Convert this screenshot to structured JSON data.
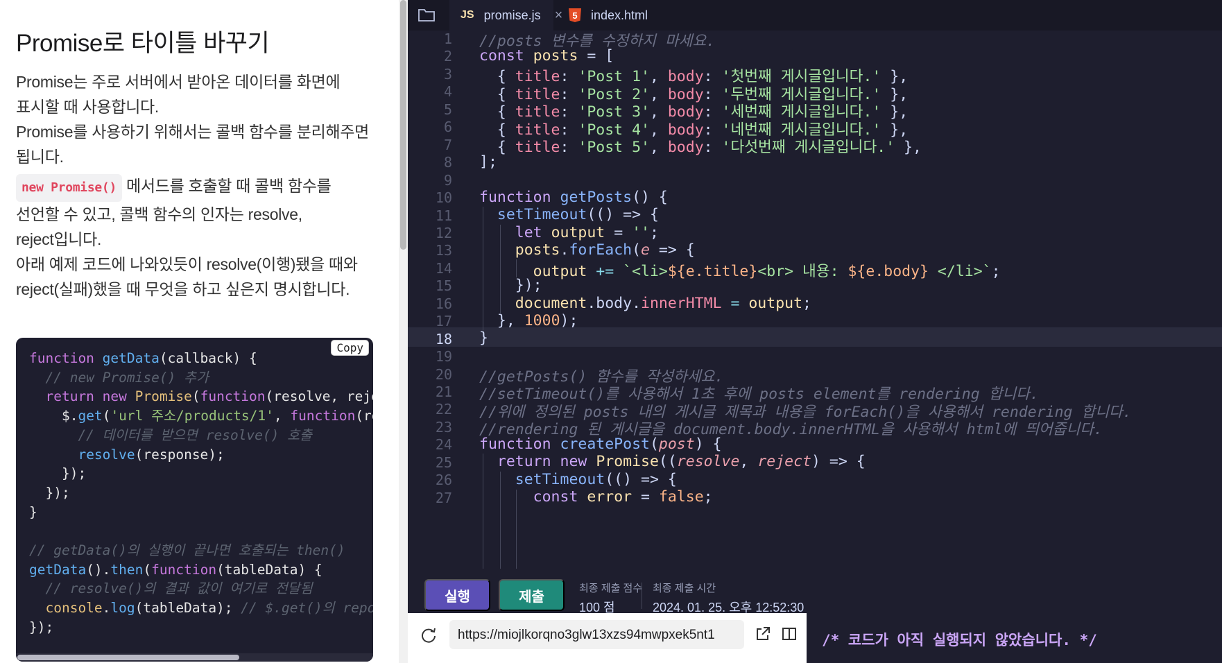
{
  "left": {
    "title": "Promise로 타이틀 바꾸기",
    "para1": [
      "Promise는 주로 서버에서 받아온 데이터를 화면에",
      "표시할 때 사용합니다.",
      "Promise를 사용하기 위해서는 콜백 함수를 분리해주면",
      "됩니다."
    ],
    "chip": "new Promise()",
    "para2_first": "메서드를 호출할 때 콜백 함수를",
    "para2": [
      "선언할 수 있고, 콜백 함수의 인자는 resolve,",
      "reject입니다.",
      "아래 예제 코드에 나와있듯이 resolve(이행)됐을 때와",
      "reject(실패)했을 때 무엇을 하고 싶은지 명시합니다."
    ],
    "copy_label": "Copy",
    "example": {
      "l1a": "function",
      "l1b": "getData",
      "l1c": "(callback) {",
      "l2": "  // new Promise() 추가",
      "l3a": "  return",
      "l3b": "new",
      "l3c": "Promise",
      "l3d": "(",
      "l3e": "function",
      "l3f": "(resolve, reject",
      "l4a": "    $.",
      "l4b": "get",
      "l4c": "(",
      "l4d": "'url 주소/products/1'",
      "l4e": ", ",
      "l4f": "function",
      "l4g": "(res",
      "l5": "      // 데이터를 받으면 resolve() 호출",
      "l6a": "      ",
      "l6b": "resolve",
      "l6c": "(response);",
      "l7": "    });",
      "l8": "  });",
      "l9": "}",
      "l10": "",
      "l11": "// getData()의 실행이 끝나면 호출되는 then()",
      "l12a": "getData",
      "l12b": "().",
      "l12c": "then",
      "l12d": "(",
      "l12e": "function",
      "l12f": "(tableData) {",
      "l13": "  // resolve()의 결과 값이 여기로 전달됨",
      "l14a": "  console",
      "l14b": ".",
      "l14c": "log",
      "l14d": "(tableData); ",
      "l14e": "// $.get()의 repons",
      "l15": "});"
    }
  },
  "tabs": {
    "active_badge": "JS",
    "active_label": "promise.js",
    "close_glyph": "×",
    "second_badge": "5",
    "second_label": "index.html"
  },
  "editor": {
    "line_numbers": [
      "1",
      "2",
      "3",
      "4",
      "5",
      "6",
      "7",
      "8",
      "9",
      "10",
      "11",
      "12",
      "13",
      "14",
      "15",
      "16",
      "17",
      "18",
      "19",
      "20",
      "21",
      "22",
      "23",
      "24",
      "25",
      "26",
      "27"
    ],
    "current_line": "18",
    "code": {
      "c1": "//posts 변수를 수정하지 마세요.",
      "c2a": "const",
      "c2b": "posts",
      "c2c": " = [",
      "p3": [
        "'Post 1'",
        "'첫번째 게시글입니다.'"
      ],
      "p4": [
        "'Post 2'",
        "'두번째 게시글입니다.'"
      ],
      "p5": [
        "'Post 3'",
        "'세번째 게시글입니다.'"
      ],
      "p6": [
        "'Post 4'",
        "'네번째 게시글입니다.'"
      ],
      "p7": [
        "'Post 5'",
        "'다섯번째 게시글입니다.'"
      ],
      "title_key": "title",
      "body_key": "body",
      "c8": "];",
      "c10a": "function",
      "c10b": "getPosts",
      "c10c": "() {",
      "c11a": "setTimeout",
      "c11b": "(() => {",
      "c12a": "let",
      "c12b": "output",
      "c12c": " = ",
      "c12d": "''",
      "c12e": ";",
      "c13a": "posts",
      "c13b": ".",
      "c13c": "forEach",
      "c13d": "(",
      "c13e": "e",
      "c13f": " => {",
      "c14a": "output",
      "c14b": " += ",
      "c14c": "`<li>",
      "c14d": "${e.title}",
      "c14e": "<br> 내용: ",
      "c14f": "${e.body}",
      "c14g": " </li>`",
      "c14h": ";",
      "c15": "});",
      "c16a": "document",
      "c16b": ".body.",
      "c16c": "innerHTML",
      "c16d": " = ",
      "c16e": "output",
      "c16f": ";",
      "c17a": "}, ",
      "c17b": "1000",
      "c17c": ");",
      "c18": "}",
      "c20": "//getPosts() 함수를 작성하세요.",
      "c21": "//setTimeout()를 사용해서 1초 후에 posts element를 rendering 합니다.",
      "c22": "//위에 정의된 posts 내의 게시글 제목과 내용을 forEach()을 사용해서 rendering 합니다.",
      "c23": "//rendering 된 게시글을 document.body.innerHTML을 사용해서 html에 띄어줍니다.",
      "c24a": "function",
      "c24b": "createPost",
      "c24c": "(",
      "c24d": "post",
      "c24e": ") {",
      "c25a": "return",
      "c25b": "new",
      "c25c": "Promise",
      "c25d": "((",
      "c25e": "resolve",
      "c25f": ", ",
      "c25g": "reject",
      "c25h": ") => {",
      "c26a": "setTimeout",
      "c26b": "(() => {",
      "c27a": "const",
      "c27b": "error",
      "c27c": " = ",
      "c27d": "false",
      "c27e": ";"
    }
  },
  "actions": {
    "run": "실행",
    "submit": "제출",
    "score_label": "최종 제출 점수",
    "score_value": "100 점",
    "time_label": "최종 제출 시간",
    "time_value": "2024. 01. 25. 오후 12:52:30"
  },
  "preview": {
    "url": "https://miojlkorqno3glw13xzs94mwpxek5nt1",
    "output": "/* 코드가 아직 실행되지 않았습니다. */"
  },
  "colors": {
    "run_button": "#5b4fb6",
    "submit_button": "#1f8a7a",
    "editor_bg": "#1e1e2e"
  },
  "icons": [
    "folder-icon",
    "close-icon",
    "html5-icon",
    "refresh-icon",
    "external-link-icon",
    "split-view-icon"
  ]
}
